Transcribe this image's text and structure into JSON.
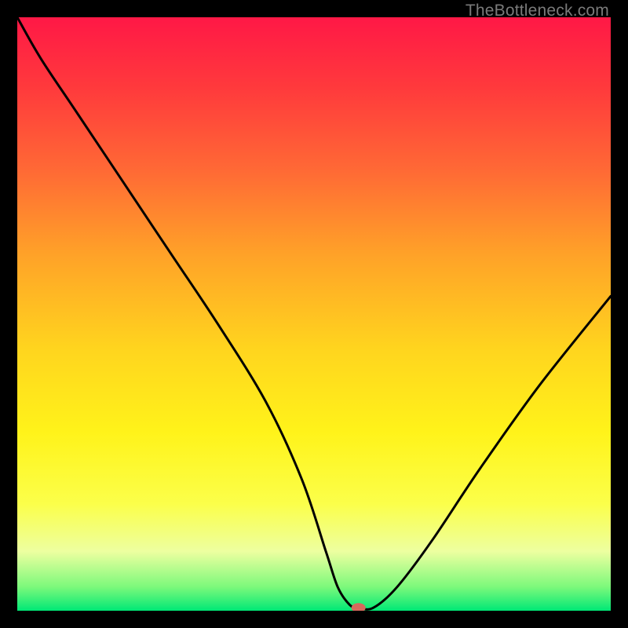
{
  "attribution": "TheBottleneck.com",
  "colors": {
    "page_bg": "#000000",
    "gradient_top": "#ff1846",
    "gradient_bottom": "#00e876",
    "curve_stroke": "#000000",
    "marker_fill": "#d66a5c"
  },
  "chart_data": {
    "type": "line",
    "title": "",
    "xlabel": "",
    "ylabel": "",
    "xlim": [
      0,
      100
    ],
    "ylim": [
      0,
      100
    ],
    "grid": false,
    "legend": false,
    "series": [
      {
        "name": "bottleneck-curve",
        "x": [
          0,
          4,
          10,
          18,
          26,
          34,
          42,
          48,
          52,
          54,
          56,
          57.5,
          60,
          64,
          70,
          78,
          88,
          100
        ],
        "values": [
          100,
          93,
          84,
          72,
          60,
          48,
          35,
          22,
          10,
          4,
          1,
          0.5,
          0.5,
          4,
          12,
          24,
          38,
          53
        ]
      }
    ],
    "marker": {
      "x": 57.5,
      "y": 0.5
    },
    "attribution": "TheBottleneck.com"
  }
}
